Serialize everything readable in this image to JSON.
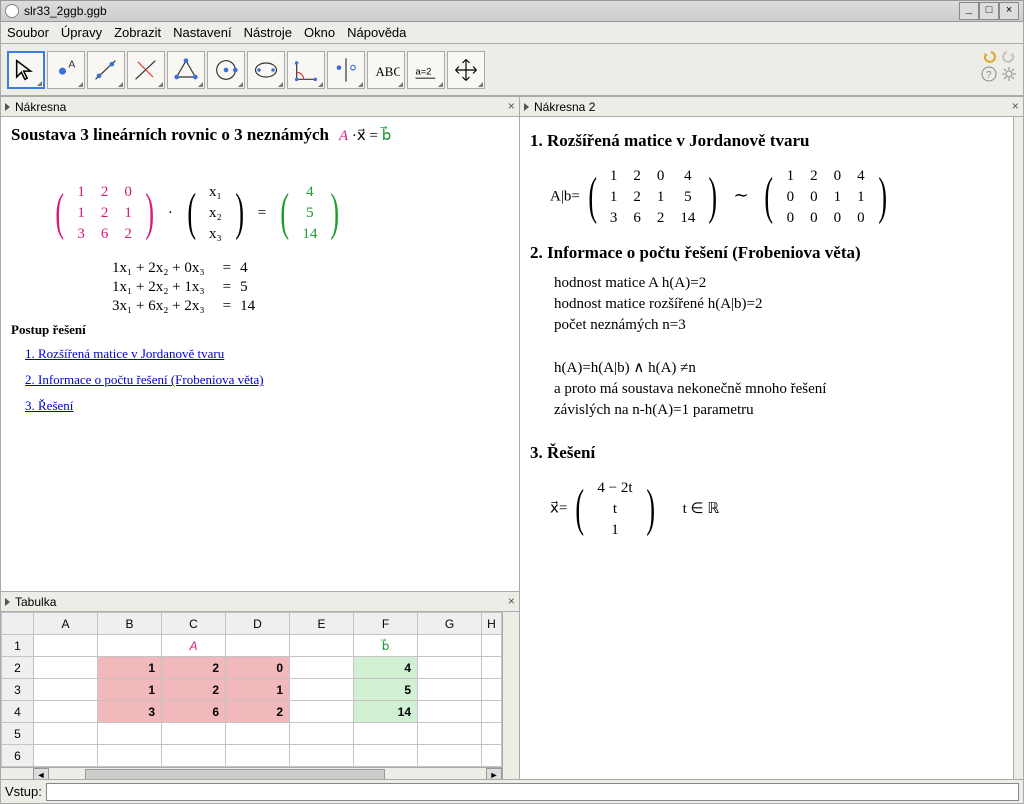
{
  "window": {
    "title": "slr33_2ggb.ggb"
  },
  "menu": [
    "Soubor",
    "Úpravy",
    "Zobrazit",
    "Nastavení",
    "Nástroje",
    "Okno",
    "Nápověda"
  ],
  "panels": {
    "nakresna": "Nákresna",
    "nakresna2": "Nákresna  2",
    "tabulka": "Tabulka"
  },
  "left": {
    "title": "Soustava 3 lineárních rovnic o 3 neznámých",
    "Axb": {
      "A": "A",
      "dot": "·",
      "x": "x⃗",
      "eq": "=",
      "b": "b⃗"
    },
    "matrixA": [
      [
        "1",
        "2",
        "0"
      ],
      [
        "1",
        "2",
        "1"
      ],
      [
        "3",
        "6",
        "2"
      ]
    ],
    "vecX": [
      "x₁",
      "x₂",
      "x₃"
    ],
    "vecB": [
      "4",
      "5",
      "14"
    ],
    "eqs": [
      {
        "lhs": "1x₁ + 2x₂ + 0x₃",
        "eq": "=",
        "rhs": "4"
      },
      {
        "lhs": "1x₁ + 2x₂ + 1x₃",
        "eq": "=",
        "rhs": "5"
      },
      {
        "lhs": "3x₁ + 6x₂ + 2x₃",
        "eq": "=",
        "rhs": "14"
      }
    ],
    "postup": "Postup řešení",
    "links": [
      "1. Rozšířená matice v Jordanově tvaru",
      "2. Informace o počtu řešení (Frobeniova věta)",
      "3. Řešení"
    ]
  },
  "right": {
    "h1": "1. Rozšířená matice v Jordanově tvaru",
    "ab_lhs": "A|b=",
    "augL": [
      [
        "1",
        "2",
        "0",
        "4"
      ],
      [
        "1",
        "2",
        "1",
        "5"
      ],
      [
        "3",
        "6",
        "2",
        "14"
      ]
    ],
    "tilde": "∼",
    "augR": [
      [
        "1",
        "2",
        "0",
        "4"
      ],
      [
        "0",
        "0",
        "1",
        "1"
      ],
      [
        "0",
        "0",
        "0",
        "0"
      ]
    ],
    "h2": "2.  Informace o počtu řešení  (Frobeniova věta)",
    "info1": "hodnost matice A h(A)=2",
    "info2": "hodnost matice rozšířené h(A|b)=2",
    "info3": "počet neznámých n=3",
    "cond": "h(A)=h(A|b) ∧ h(A)  ≠n",
    "concl1": "a proto má soustava nekonečně mnoho řešení",
    "concl2": "závislých na n-h(A)=1 parametru",
    "h3": "3. Řešení",
    "solX": "x⃗=",
    "solVec": [
      "4 − 2t",
      "t",
      "1"
    ],
    "solCond": "t ∈ ℝ"
  },
  "sheet": {
    "cols": [
      "A",
      "B",
      "C",
      "D",
      "E",
      "F",
      "G",
      "H"
    ],
    "rows": [
      "1",
      "2",
      "3",
      "4",
      "5",
      "6"
    ],
    "labelA": "A",
    "labelB": "b⃗",
    "data": {
      "B2": "1",
      "C2": "2",
      "D2": "0",
      "F2": "4",
      "B3": "1",
      "C3": "2",
      "D3": "1",
      "F3": "5",
      "B4": "3",
      "C4": "6",
      "D4": "2",
      "F4": "14"
    }
  },
  "inputbar": {
    "label": "Vstup:"
  }
}
